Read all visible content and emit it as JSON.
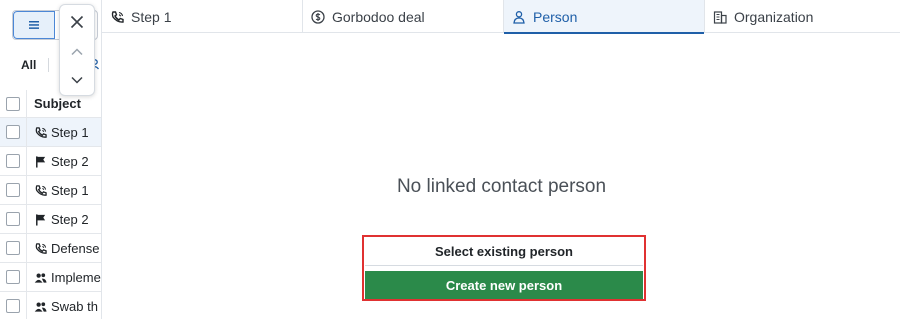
{
  "filter": {
    "all_label": "All"
  },
  "grid": {
    "header": "Subject",
    "rows": [
      {
        "icon": "phone-icon",
        "label": "Step 1",
        "selected": true
      },
      {
        "icon": "flag-icon",
        "label": "Step 2",
        "selected": false
      },
      {
        "icon": "phone-icon",
        "label": "Step 1",
        "selected": false
      },
      {
        "icon": "flag-icon",
        "label": "Step 2",
        "selected": false
      },
      {
        "icon": "phone-icon",
        "label": "Defense",
        "selected": false
      },
      {
        "icon": "people-icon",
        "label": "Impleme",
        "selected": false
      },
      {
        "icon": "people-icon",
        "label": "Swab th",
        "selected": false
      }
    ]
  },
  "tabs": [
    {
      "icon": "phone-icon",
      "label": "Step 1",
      "active": false
    },
    {
      "icon": "dollar-icon",
      "label": "Gorbodoo deal",
      "active": false
    },
    {
      "icon": "person-icon",
      "label": "Person",
      "active": true
    },
    {
      "icon": "building-icon",
      "label": "Organization",
      "active": false
    }
  ],
  "person_panel": {
    "empty_message": "No linked contact person",
    "select_button": "Select existing person",
    "create_button": "Create new person"
  },
  "colors": {
    "accent": "#1f5fa8",
    "create": "#2b8a4a",
    "highlight": "#e03131"
  }
}
